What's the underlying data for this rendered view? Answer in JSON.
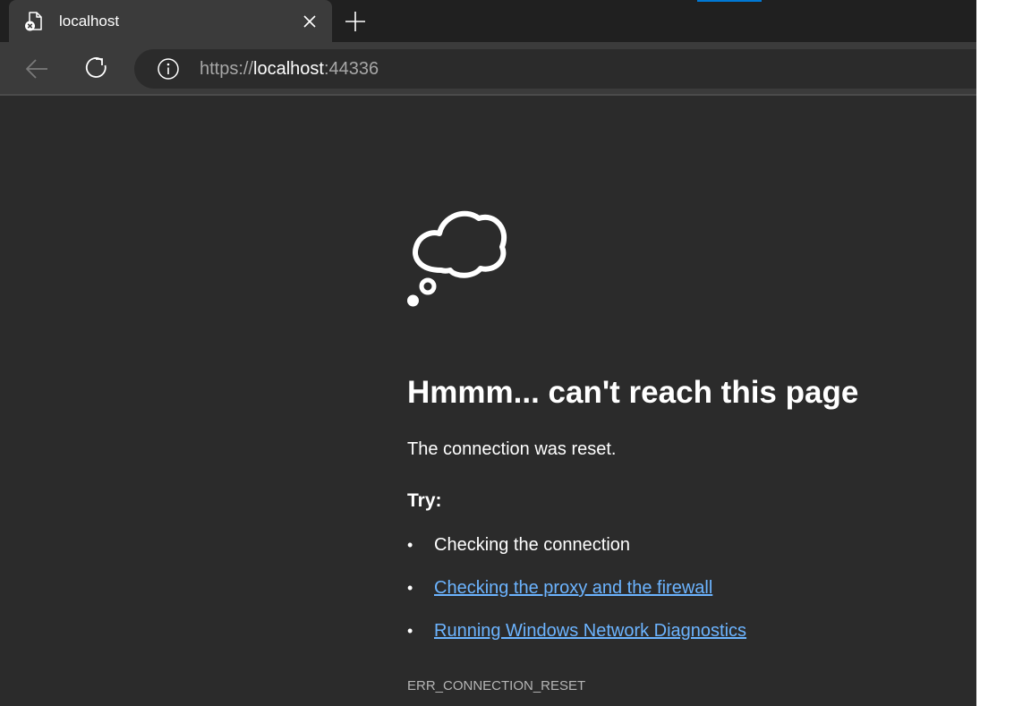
{
  "browser": {
    "accent_color": "#0078d4",
    "tab": {
      "title": "localhost",
      "favicon": "file-error-icon",
      "close": "close-icon"
    },
    "new_tab": "plus-icon",
    "toolbar": {
      "back": "back-arrow-icon",
      "refresh": "refresh-icon",
      "site_info": "info-icon"
    },
    "address": {
      "scheme": "https://",
      "host": "localhost",
      "port": ":44336"
    }
  },
  "page": {
    "illustration": "thought-cloud-icon",
    "heading": "Hmmm... can't reach this page",
    "message": "The connection was reset.",
    "try_label": "Try:",
    "suggestions": [
      {
        "text": "Checking the connection",
        "is_link": false
      },
      {
        "text": "Checking the proxy and the firewall",
        "is_link": true
      },
      {
        "text": "Running Windows Network Diagnostics",
        "is_link": true
      }
    ],
    "bullet": "•",
    "error_code": "ERR_CONNECTION_RESET",
    "link_color": "#6cb4ff",
    "background_color": "#2b2b2b"
  }
}
